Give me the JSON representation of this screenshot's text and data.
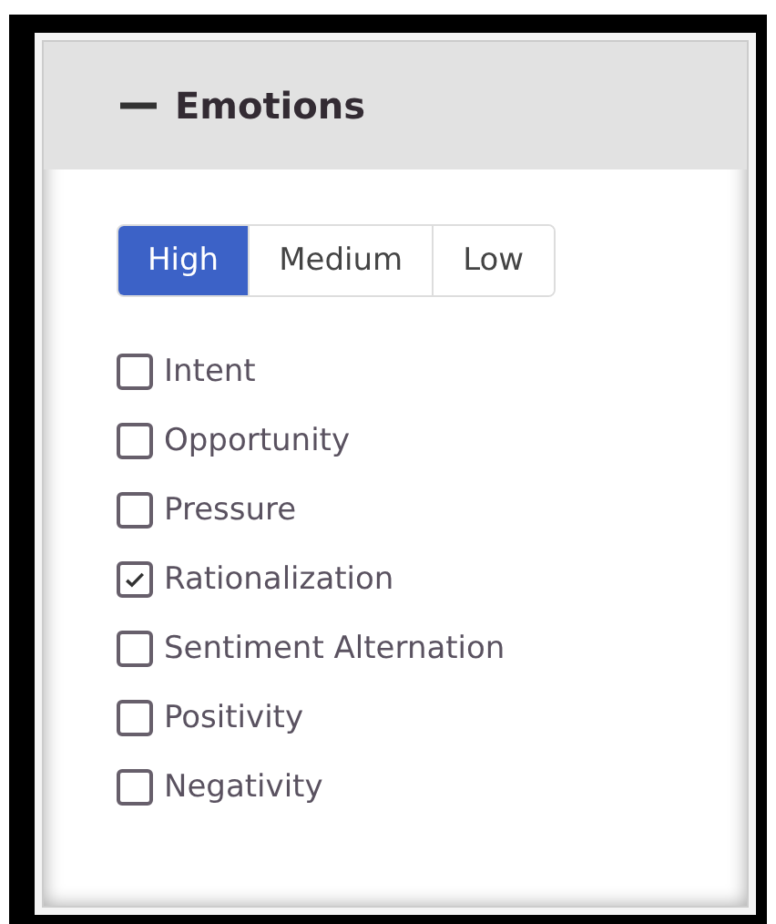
{
  "panel": {
    "title": "Emotions",
    "expanded": true
  },
  "levels": [
    {
      "label": "High",
      "selected": true
    },
    {
      "label": "Medium",
      "selected": false
    },
    {
      "label": "Low",
      "selected": false
    }
  ],
  "options": [
    {
      "label": "Intent",
      "checked": false
    },
    {
      "label": "Opportunity",
      "checked": false
    },
    {
      "label": "Pressure",
      "checked": false
    },
    {
      "label": "Rationalization",
      "checked": true
    },
    {
      "label": "Sentiment Alternation",
      "checked": false
    },
    {
      "label": "Positivity",
      "checked": false
    },
    {
      "label": "Negativity",
      "checked": false
    }
  ]
}
